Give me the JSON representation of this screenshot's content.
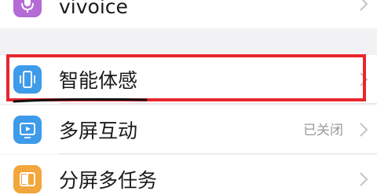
{
  "settings": {
    "items": [
      {
        "label": "vivoice",
        "icon": "microphone-icon",
        "icon_color": "#b56bd6"
      },
      {
        "label": "智能体感",
        "icon": "phone-vibrate-icon",
        "icon_color": "#3d9be9"
      },
      {
        "label": "多屏互动",
        "icon": "screen-share-icon",
        "icon_color": "#3d9be9",
        "status": "已关闭"
      },
      {
        "label": "分屏多任务",
        "icon": "split-screen-icon",
        "icon_color": "#f3a63b"
      }
    ]
  },
  "annotation": {
    "highlight_color": "#e8262d"
  }
}
